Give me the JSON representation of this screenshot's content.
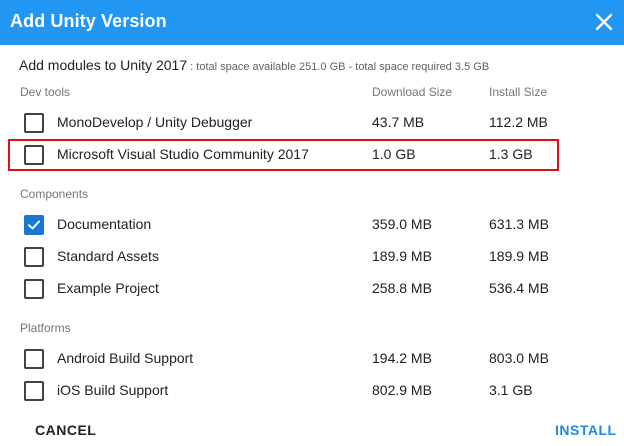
{
  "title": "Add Unity Version",
  "subtitle": {
    "main": "Add modules to Unity 2017",
    "space": " : total space available 251.0 GB - total space required 3.5 GB"
  },
  "columns": {
    "download": "Download Size",
    "install": "Install Size"
  },
  "sections": [
    {
      "label": "Dev tools",
      "items": [
        {
          "name": "MonoDevelop / Unity Debugger",
          "download": "43.7 MB",
          "install": "112.2 MB",
          "checked": false
        },
        {
          "name": "Microsoft Visual Studio Community 2017",
          "download": "1.0 GB",
          "install": "1.3 GB",
          "checked": false
        }
      ]
    },
    {
      "label": "Components",
      "items": [
        {
          "name": "Documentation",
          "download": "359.0 MB",
          "install": "631.3 MB",
          "checked": true
        },
        {
          "name": "Standard Assets",
          "download": "189.9 MB",
          "install": "189.9 MB",
          "checked": false
        },
        {
          "name": "Example Project",
          "download": "258.8 MB",
          "install": "536.4 MB",
          "checked": false
        }
      ]
    },
    {
      "label": "Platforms",
      "items": [
        {
          "name": "Android Build Support",
          "download": "194.2 MB",
          "install": "803.0 MB",
          "checked": false
        },
        {
          "name": "iOS Build Support",
          "download": "802.9 MB",
          "install": "3.1 GB",
          "checked": false
        }
      ]
    }
  ],
  "buttons": {
    "cancel": "CANCEL",
    "install": "INSTALL"
  },
  "colors": {
    "titlebar": "#2196f3",
    "accent": "#1e88e5",
    "highlight": "#e0101a"
  },
  "icons": {
    "close": "close-icon",
    "check": "check-icon"
  }
}
